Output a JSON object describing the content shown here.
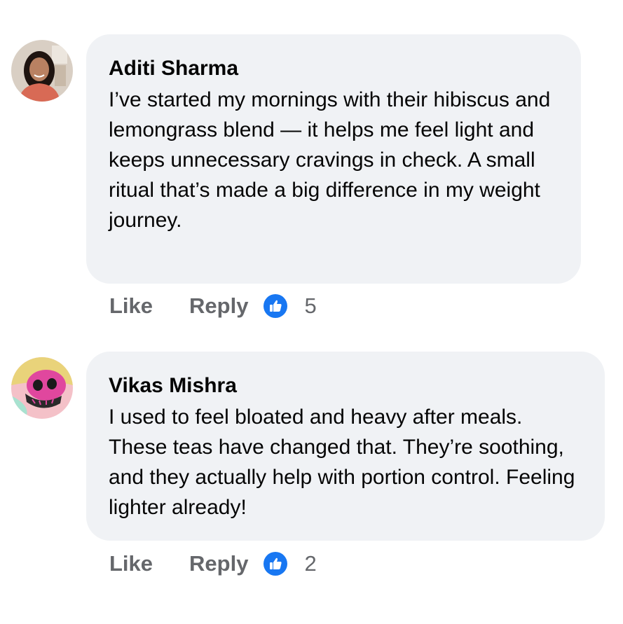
{
  "comments": [
    {
      "author": "Aditi Sharma",
      "text": "I’ve started my mornings with their hibiscus and lemongrass blend — it helps me feel light and keeps unnecessary cravings in check. A small ritual that’s made a big difference in my weight journey.",
      "like_label": "Like",
      "reply_label": "Reply",
      "reaction_count": "5",
      "reaction_icon": "thumbs-up-icon"
    },
    {
      "author": "Vikas Mishra",
      "text": "I used to feel bloated and heavy after meals. These teas have changed that. They’re soothing, and they actually help with portion control. Feeling lighter already!",
      "like_label": "Like",
      "reply_label": "Reply",
      "reaction_count": "2",
      "reaction_icon": "thumbs-up-icon"
    }
  ],
  "colors": {
    "bubble": "#f0f2f5",
    "action_text": "#65676b",
    "like_blue": "#1877f2"
  }
}
